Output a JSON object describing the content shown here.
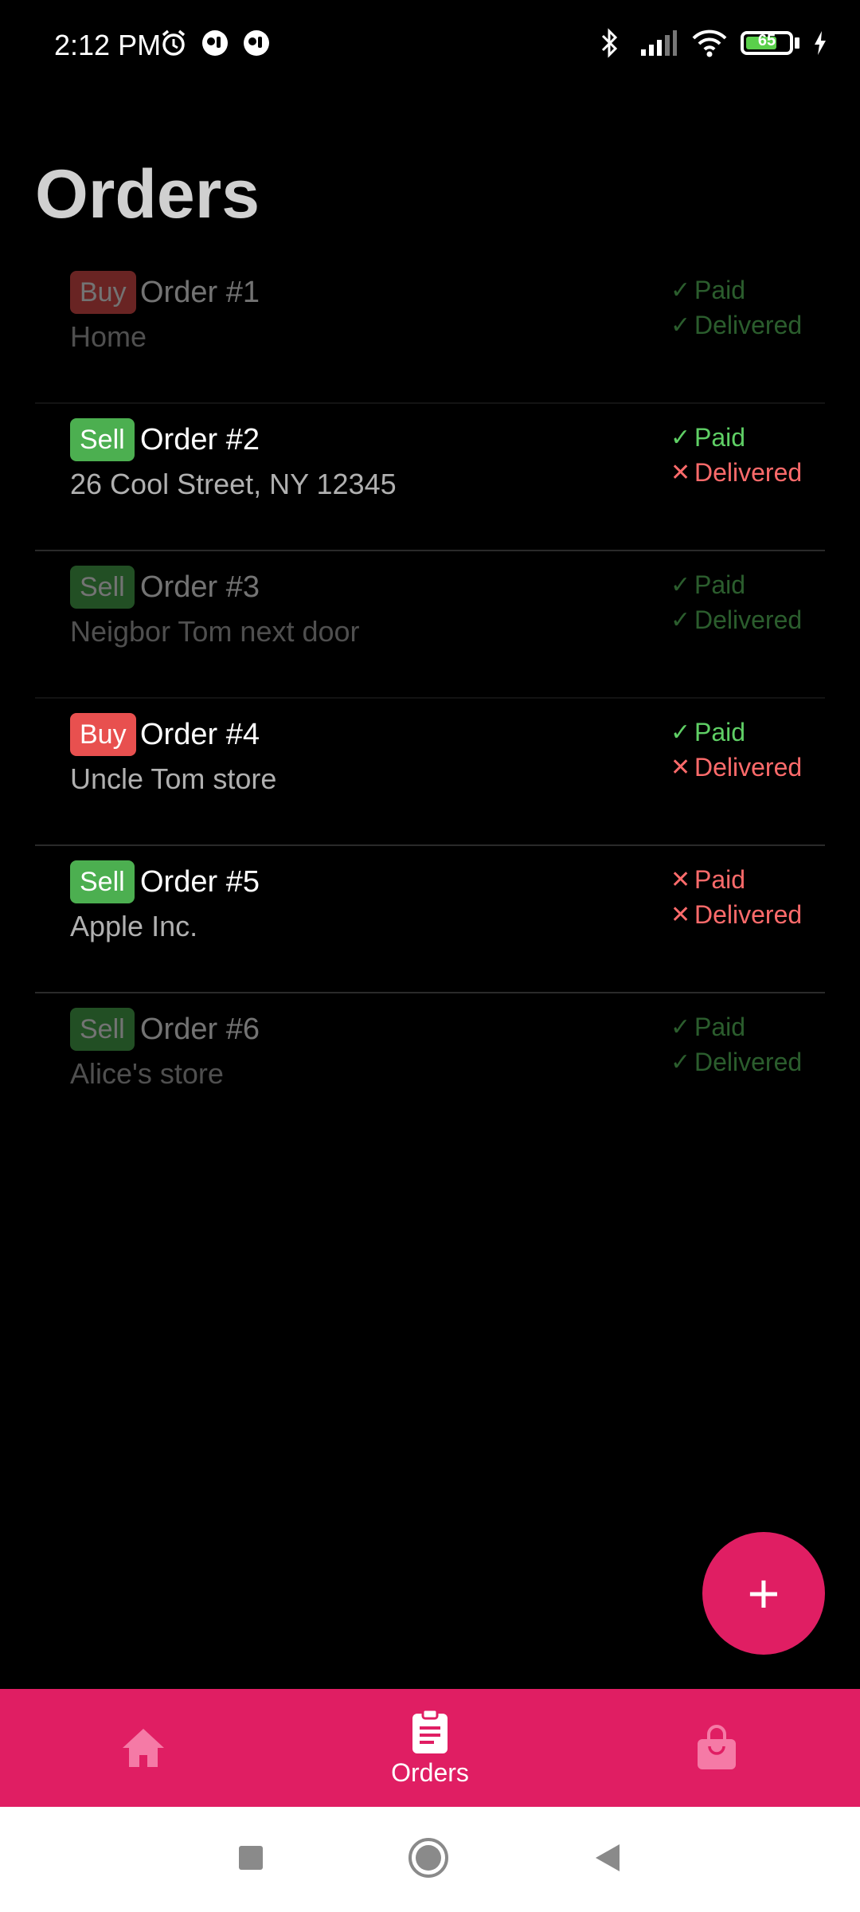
{
  "status_bar": {
    "time": "2:12 PM",
    "battery_level": "65",
    "icons_left": [
      "alarm-icon",
      "notification-icon",
      "notification-icon"
    ],
    "icons_right": [
      "bluetooth-icon",
      "signal-icon",
      "wifi-icon",
      "battery-icon",
      "charging-icon"
    ]
  },
  "page": {
    "title": "Orders"
  },
  "orders": [
    {
      "type": "Buy",
      "title": "Order #1",
      "subtitle": "Home",
      "paid": true,
      "delivered": true,
      "dimmed": true,
      "paid_label": "Paid",
      "delivered_label": "Delivered"
    },
    {
      "type": "Sell",
      "title": "Order #2",
      "subtitle": "26 Cool Street, NY 12345",
      "paid": true,
      "delivered": false,
      "dimmed": false,
      "paid_label": "Paid",
      "delivered_label": "Delivered"
    },
    {
      "type": "Sell",
      "title": "Order #3",
      "subtitle": "Neigbor Tom next door",
      "paid": true,
      "delivered": true,
      "dimmed": true,
      "paid_label": "Paid",
      "delivered_label": "Delivered"
    },
    {
      "type": "Buy",
      "title": "Order #4",
      "subtitle": "Uncle Tom store",
      "paid": true,
      "delivered": false,
      "dimmed": false,
      "paid_label": "Paid",
      "delivered_label": "Delivered"
    },
    {
      "type": "Sell",
      "title": "Order #5",
      "subtitle": "Apple Inc.",
      "paid": false,
      "delivered": false,
      "dimmed": false,
      "paid_label": "Paid",
      "delivered_label": "Delivered"
    },
    {
      "type": "Sell",
      "title": "Order #6",
      "subtitle": "Alice's store",
      "paid": true,
      "delivered": true,
      "dimmed": true,
      "paid_label": "Paid",
      "delivered_label": "Delivered"
    }
  ],
  "colors": {
    "buy": "#e8504f",
    "sell": "#4caf50",
    "accent": "#e01e63",
    "ok": "#5fcf65",
    "bad": "#ff6b6b"
  },
  "fab": {
    "icon": "plus-icon",
    "symbol": "+"
  },
  "bottom_nav": {
    "items": [
      {
        "icon": "home-icon",
        "label": ""
      },
      {
        "icon": "clipboard-icon",
        "label": "Orders"
      },
      {
        "icon": "shopping-bag-icon",
        "label": ""
      }
    ]
  },
  "system_nav": {
    "items": [
      "recents-icon",
      "home-circle-icon",
      "back-icon"
    ]
  }
}
